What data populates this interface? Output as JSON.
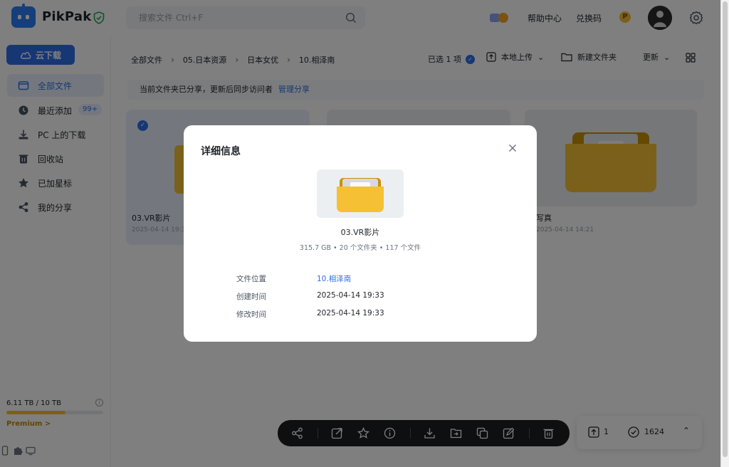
{
  "app": {
    "brand": "PikPak"
  },
  "topbar": {
    "search_placeholder": "搜索文件 Ctrl+F",
    "help_label": "帮助中心",
    "redeem_label": "兑换码",
    "premium_badge": "P"
  },
  "sidebar": {
    "cloud_download_label": "云下载",
    "items": [
      {
        "label": "全部文件",
        "icon": "folder-icon",
        "active": true
      },
      {
        "label": "最近添加",
        "icon": "clock-icon",
        "count": "99+"
      },
      {
        "label": "PC 上的下载",
        "icon": "download-icon"
      },
      {
        "label": "回收站",
        "icon": "trash-icon"
      },
      {
        "label": "已加星标",
        "icon": "star-icon"
      },
      {
        "label": "我的分享",
        "icon": "share-icon"
      }
    ],
    "storage_text": "6.11 TB / 10 TB",
    "storage_used_fraction": 0.611,
    "premium_label": "Premium >"
  },
  "main": {
    "breadcrumbs": [
      "全部文件",
      "05.日本资源",
      "日本女优",
      "10.相泽南"
    ],
    "selected_text": "已选 1 项",
    "upload_label": "本地上传",
    "new_folder_label": "新建文件夹",
    "sort_label": "更新",
    "notice_text": "当前文件夹已分享，更新后同步访问者",
    "notice_link": "管理分享",
    "cards": [
      {
        "title": "03.VR影片",
        "date": "2025-04-14 19:33",
        "selected": true
      },
      {
        "title": "",
        "date": ""
      },
      {
        "title": "写真",
        "date": "2025-04-14 14:21"
      }
    ]
  },
  "transfer": {
    "upload_count": "1",
    "done_count": "1624"
  },
  "modal": {
    "title": "详细信息",
    "file_name": "03.VR影片",
    "meta": "315.7 GB • 20 个文件夹 • 117 个文件",
    "rows": [
      {
        "key": "文件位置",
        "value": "10.相泽南"
      },
      {
        "key": "创建时间",
        "value": "2025-04-14 19:33"
      },
      {
        "key": "修改时间",
        "value": "2025-04-14 19:33"
      }
    ]
  },
  "colors": {
    "accent": "#2f6fe8",
    "folder": "#f5c034",
    "overlay": "rgba(0,0,0,0.5)"
  }
}
